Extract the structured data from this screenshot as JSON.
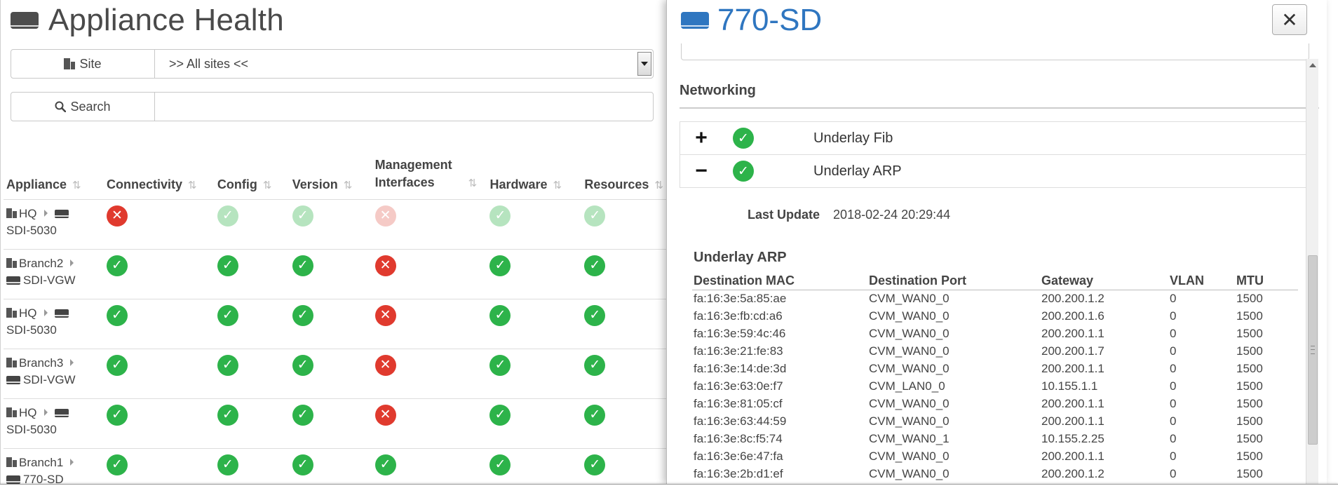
{
  "colors": {
    "ok": "#2db34a",
    "error": "#e03a2e",
    "device_title": "#2f76c0"
  },
  "left": {
    "title": "Appliance Health",
    "site": {
      "label": "Site",
      "value": ">> All sites <<"
    },
    "search": {
      "label": "Search",
      "value": ""
    },
    "columns": [
      {
        "label": "Appliance",
        "sort_icon": "sort-icon"
      },
      {
        "label": "Connectivity",
        "sort_icon": "sort-icon"
      },
      {
        "label": "Config",
        "sort_icon": "sort-icon"
      },
      {
        "label": "Version",
        "sort_icon": "sort-icon"
      },
      {
        "label": "Management Interfaces",
        "sort_icon": "sort-icon"
      },
      {
        "label": "Hardware",
        "sort_icon": "sort-icon"
      },
      {
        "label": "Resources",
        "sort_icon": "sort-icon"
      }
    ],
    "rows": [
      {
        "site": "HQ",
        "device": "SDI-5030",
        "status": [
          {
            "state": "error",
            "faded": false
          },
          {
            "state": "ok",
            "faded": true
          },
          {
            "state": "ok",
            "faded": true
          },
          {
            "state": "error",
            "faded": true
          },
          {
            "state": "ok",
            "faded": true
          },
          {
            "state": "ok",
            "faded": true
          }
        ]
      },
      {
        "site": "Branch2",
        "device": "SDI-VGW",
        "status": [
          {
            "state": "ok"
          },
          {
            "state": "ok"
          },
          {
            "state": "ok"
          },
          {
            "state": "error"
          },
          {
            "state": "ok"
          },
          {
            "state": "ok"
          }
        ]
      },
      {
        "site": "HQ",
        "device": "SDI-5030",
        "status": [
          {
            "state": "ok"
          },
          {
            "state": "ok"
          },
          {
            "state": "ok"
          },
          {
            "state": "error"
          },
          {
            "state": "ok"
          },
          {
            "state": "ok"
          }
        ]
      },
      {
        "site": "Branch3",
        "device": "SDI-VGW",
        "status": [
          {
            "state": "ok"
          },
          {
            "state": "ok"
          },
          {
            "state": "ok"
          },
          {
            "state": "error"
          },
          {
            "state": "ok"
          },
          {
            "state": "ok"
          }
        ]
      },
      {
        "site": "HQ",
        "device": "SDI-5030",
        "status": [
          {
            "state": "ok"
          },
          {
            "state": "ok"
          },
          {
            "state": "ok"
          },
          {
            "state": "error"
          },
          {
            "state": "ok"
          },
          {
            "state": "ok"
          }
        ]
      },
      {
        "site": "Branch1",
        "device": "770-SD",
        "status": [
          {
            "state": "ok"
          },
          {
            "state": "ok"
          },
          {
            "state": "ok"
          },
          {
            "state": "ok"
          },
          {
            "state": "ok"
          },
          {
            "state": "ok"
          }
        ]
      }
    ]
  },
  "right": {
    "title": "770-SD",
    "close_icon": "close-icon",
    "section": "Networking",
    "expanders": [
      {
        "toggle": "+",
        "label": "Underlay Fib",
        "state": "ok"
      },
      {
        "toggle": "−",
        "label": "Underlay ARP",
        "state": "ok"
      }
    ],
    "last_update": {
      "label": "Last Update",
      "value": "2018-02-24 20:29:44"
    },
    "arp_title": "Underlay ARP",
    "arp_columns": [
      "Destination MAC",
      "Destination Port",
      "Gateway",
      "VLAN",
      "MTU"
    ],
    "arp_rows": [
      [
        "fa:16:3e:5a:85:ae",
        "CVM_WAN0_0",
        "200.200.1.2",
        "0",
        "1500"
      ],
      [
        "fa:16:3e:fb:cd:a6",
        "CVM_WAN0_0",
        "200.200.1.6",
        "0",
        "1500"
      ],
      [
        "fa:16:3e:59:4c:46",
        "CVM_WAN0_0",
        "200.200.1.1",
        "0",
        "1500"
      ],
      [
        "fa:16:3e:21:fe:83",
        "CVM_WAN0_0",
        "200.200.1.7",
        "0",
        "1500"
      ],
      [
        "fa:16:3e:14:de:3d",
        "CVM_WAN0_0",
        "200.200.1.1",
        "0",
        "1500"
      ],
      [
        "fa:16:3e:63:0e:f7",
        "CVM_LAN0_0",
        "10.155.1.1",
        "0",
        "1500"
      ],
      [
        "fa:16:3e:81:05:cf",
        "CVM_WAN0_0",
        "200.200.1.1",
        "0",
        "1500"
      ],
      [
        "fa:16:3e:63:44:59",
        "CVM_WAN0_0",
        "200.200.1.1",
        "0",
        "1500"
      ],
      [
        "fa:16:3e:8c:f5:74",
        "CVM_WAN0_1",
        "10.155.2.25",
        "0",
        "1500"
      ],
      [
        "fa:16:3e:6e:47:fa",
        "CVM_WAN0_0",
        "200.200.1.1",
        "0",
        "1500"
      ],
      [
        "fa:16:3e:2b:d1:ef",
        "CVM_WAN0_0",
        "200.200.1.2",
        "0",
        "1500"
      ]
    ]
  }
}
